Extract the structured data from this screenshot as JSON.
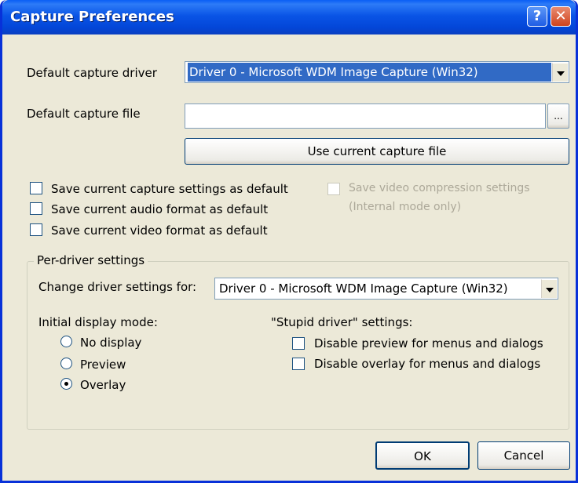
{
  "window": {
    "title": "Capture Preferences",
    "help_glyph": "?",
    "close_glyph": "✕"
  },
  "capture_driver": {
    "label": "Default capture driver",
    "selected": "Driver 0 - Microsoft WDM Image Capture (Win32)"
  },
  "capture_file": {
    "label": "Default capture file",
    "value": "",
    "browse_label": "...",
    "use_current_label": "Use current capture file"
  },
  "save_options": {
    "capture_settings": {
      "label": "Save current capture settings as default",
      "checked": false
    },
    "audio_format": {
      "label": "Save current audio format as default",
      "checked": false
    },
    "video_format": {
      "label": "Save current video format as default",
      "checked": false
    },
    "video_compression": {
      "label_line1": "Save video compression settings",
      "label_line2": "(Internal mode only)",
      "checked": false,
      "disabled": true
    }
  },
  "per_driver": {
    "group_title": "Per-driver settings",
    "change_label": "Change driver settings for:",
    "selected_driver": "Driver 0 - Microsoft WDM Image Capture (Win32)",
    "display_mode": {
      "label": "Initial display mode:",
      "options": [
        "No display",
        "Preview",
        "Overlay"
      ],
      "selected": "Overlay"
    },
    "stupid_driver": {
      "label": "\"Stupid driver\" settings:",
      "disable_preview": {
        "label": "Disable preview for menus and dialogs",
        "checked": false
      },
      "disable_overlay": {
        "label": "Disable overlay for menus and dialogs",
        "checked": false
      }
    }
  },
  "buttons": {
    "ok": "OK",
    "cancel": "Cancel"
  },
  "colors": {
    "title_bar": "#0A55E6",
    "dialog_bg": "#ECE9D8",
    "selection": "#316AC5",
    "close_button": "#D0431E"
  }
}
